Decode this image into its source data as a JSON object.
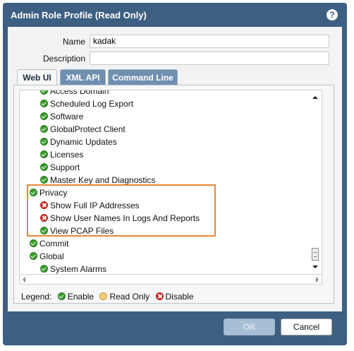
{
  "dialog": {
    "title": "Admin Role Profile (Read Only)",
    "help_icon": "?"
  },
  "form": {
    "name_label": "Name",
    "name_value": "kadak",
    "description_label": "Description",
    "description_value": ""
  },
  "tabs": [
    {
      "label": "Web UI",
      "active": true
    },
    {
      "label": "XML API",
      "active": false
    },
    {
      "label": "Command Line",
      "active": false
    }
  ],
  "tree": [
    {
      "label": "Access Domain",
      "status": "enable"
    },
    {
      "label": "Scheduled Log Export",
      "status": "enable"
    },
    {
      "label": "Software",
      "status": "enable"
    },
    {
      "label": "GlobalProtect Client",
      "status": "enable"
    },
    {
      "label": "Dynamic Updates",
      "status": "enable"
    },
    {
      "label": "Licenses",
      "status": "enable"
    },
    {
      "label": "Support",
      "status": "enable"
    },
    {
      "label": "Master Key and Diagnostics",
      "status": "enable"
    },
    {
      "label": "Privacy",
      "status": "enable"
    },
    {
      "label": "Show Full IP Addresses",
      "status": "disable"
    },
    {
      "label": "Show User Names In Logs And Reports",
      "status": "disable"
    },
    {
      "label": "View PCAP Files",
      "status": "enable"
    },
    {
      "label": "Commit",
      "status": "enable"
    },
    {
      "label": "Global",
      "status": "enable"
    },
    {
      "label": "System Alarms",
      "status": "enable"
    }
  ],
  "legend": {
    "label": "Legend:",
    "enable": "Enable",
    "read_only": "Read Only",
    "disable": "Disable"
  },
  "buttons": {
    "ok": "OK",
    "cancel": "Cancel"
  },
  "colors": {
    "title_bar": "#3d5f82",
    "enable": "#3a9b2d",
    "disable": "#d0302a",
    "highlight_border": "#e8873a"
  }
}
